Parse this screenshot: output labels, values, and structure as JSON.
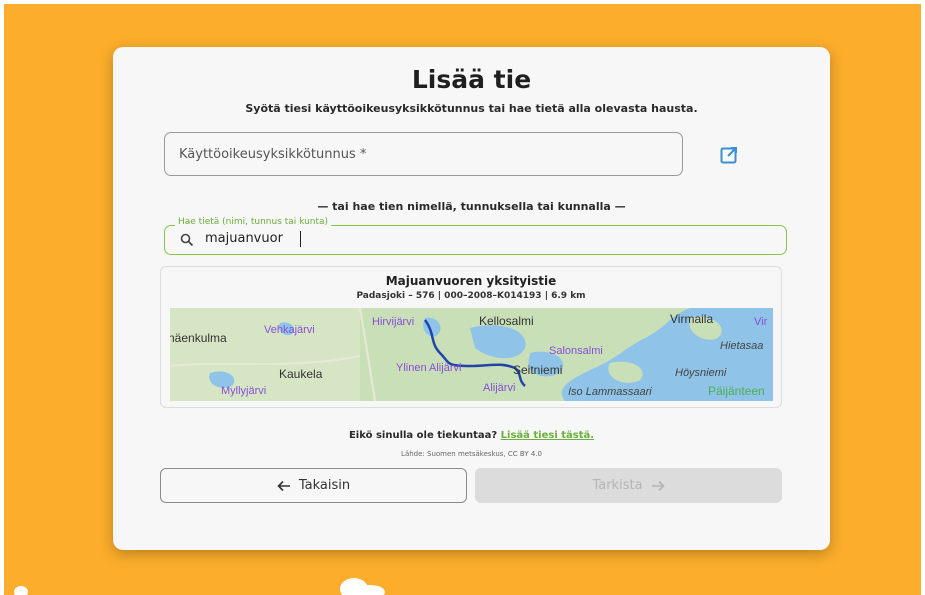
{
  "page": {
    "title": "Lisää tie",
    "subtitle": "Syötä tiesi käyttöoikeusyksikkötunnus tai hae tietä alla olevasta hausta."
  },
  "code_input": {
    "placeholder": "Käyttöoikeusyksikkötunnus *"
  },
  "divider_text": "— tai hae tien nimellä, tunnuksella tai kunnalla —",
  "search": {
    "label": "Hae tietä (nimi, tunnus tai kunta)",
    "value": "majuanvuor"
  },
  "result": {
    "name": "Majuanvuoren yksityistie",
    "meta": "Padasjoki – 576 | 000–2008–K014193 | 6.9 km",
    "map_labels": {
      "naenkulma": "näenkulma",
      "vehkajarvi": "Vehkajärvi",
      "hirvijarvi": "Hirvijärvi",
      "kellosalmi": "Kellosalmi",
      "virmaila": "Virmaila",
      "vir": "Vir",
      "hietasaa": "Hietasaa",
      "salonsalmi": "Salonsalmi",
      "kaukela": "Kaukela",
      "ylinen_alijarvi": "Ylinen Alijärvi",
      "seitniemi": "Seitniemi",
      "hoysniemi": "Höysniemi",
      "myllyjarvi": "Myllyjärvi",
      "alijarvi": "Alijärvi",
      "iso_lammassaari": "Iso Lammassaari",
      "paijanne": "Päijänteen"
    }
  },
  "footer": {
    "question": "Eikö sinulla ole tiekuntaa?",
    "link": "Lisää tiesi tästä.",
    "source": "Lähde: Suomen metsäkeskus, CC BY 4.0"
  },
  "buttons": {
    "back_label": "Takaisin",
    "check_label": "Tarkista"
  },
  "colors": {
    "background": "#fbad2b",
    "accent_green": "#6aae3b",
    "link_blue": "#3a8fd6",
    "route_blue": "#2244aa"
  },
  "icons": {
    "external_link": "external-link-icon",
    "search": "search-icon",
    "back": "arrow-left-icon",
    "check": "arrow-right-icon"
  }
}
